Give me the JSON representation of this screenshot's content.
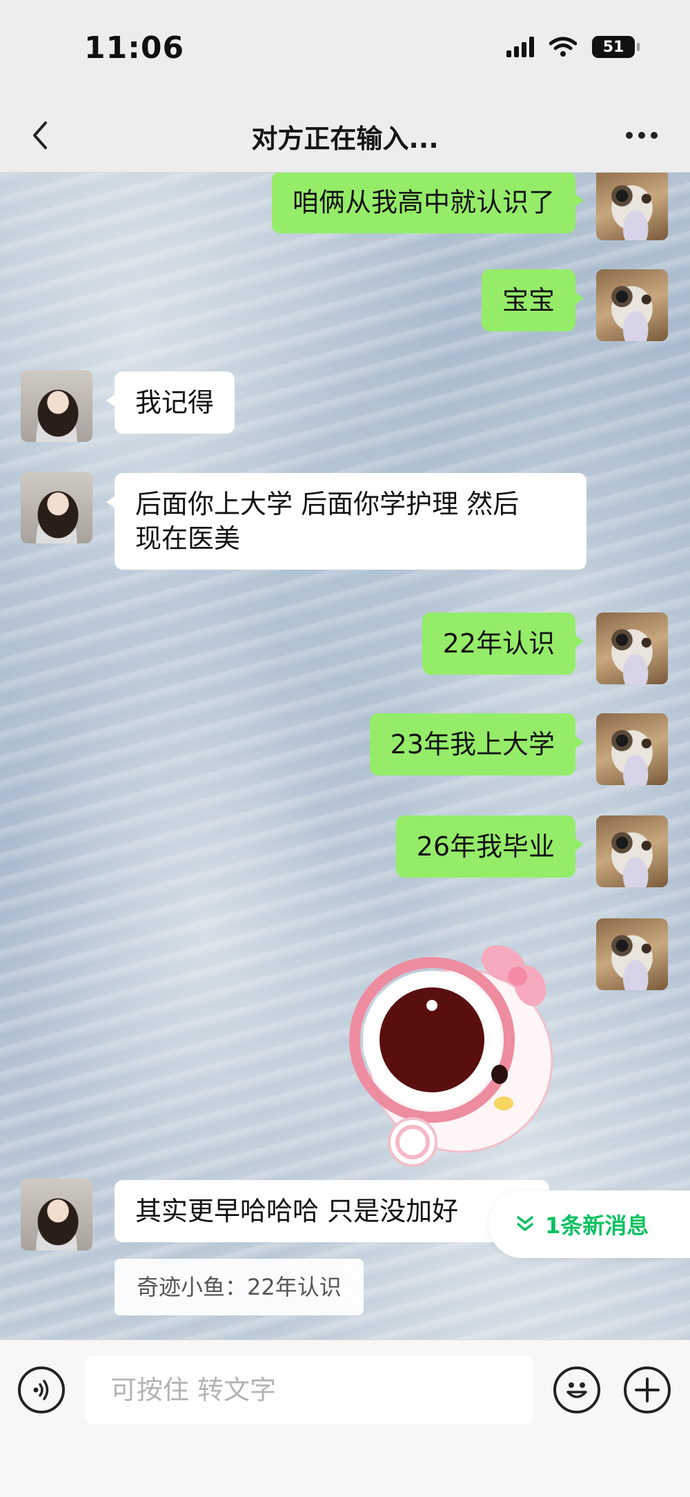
{
  "status_bar": {
    "time": "11:06",
    "battery": "51"
  },
  "header": {
    "title": "对方正在输入..."
  },
  "messages": [
    {
      "from": "me",
      "text": "咱俩从我高中就认识了"
    },
    {
      "from": "me",
      "text": "宝宝"
    },
    {
      "from": "them",
      "text": "我记得"
    },
    {
      "from": "them",
      "line1": "后面你上大学 后面你学护理 然后",
      "line2": "现在医美"
    },
    {
      "from": "me",
      "text": "22年认识"
    },
    {
      "from": "me",
      "text": "23年我上大学"
    },
    {
      "from": "me",
      "text": "26年我毕业"
    },
    {
      "from": "me",
      "type": "sticker"
    },
    {
      "from": "them",
      "text": "其实更早哈哈哈 只是没加好"
    }
  ],
  "quote": {
    "text": "奇迹小鱼：22年认识"
  },
  "new_message_pill": {
    "label": "1条新消息"
  },
  "input": {
    "placeholder": "可按住 转文字"
  },
  "colors": {
    "my_bubble": "#95ec69",
    "their_bubble": "#ffffff",
    "accent": "#07c160"
  }
}
